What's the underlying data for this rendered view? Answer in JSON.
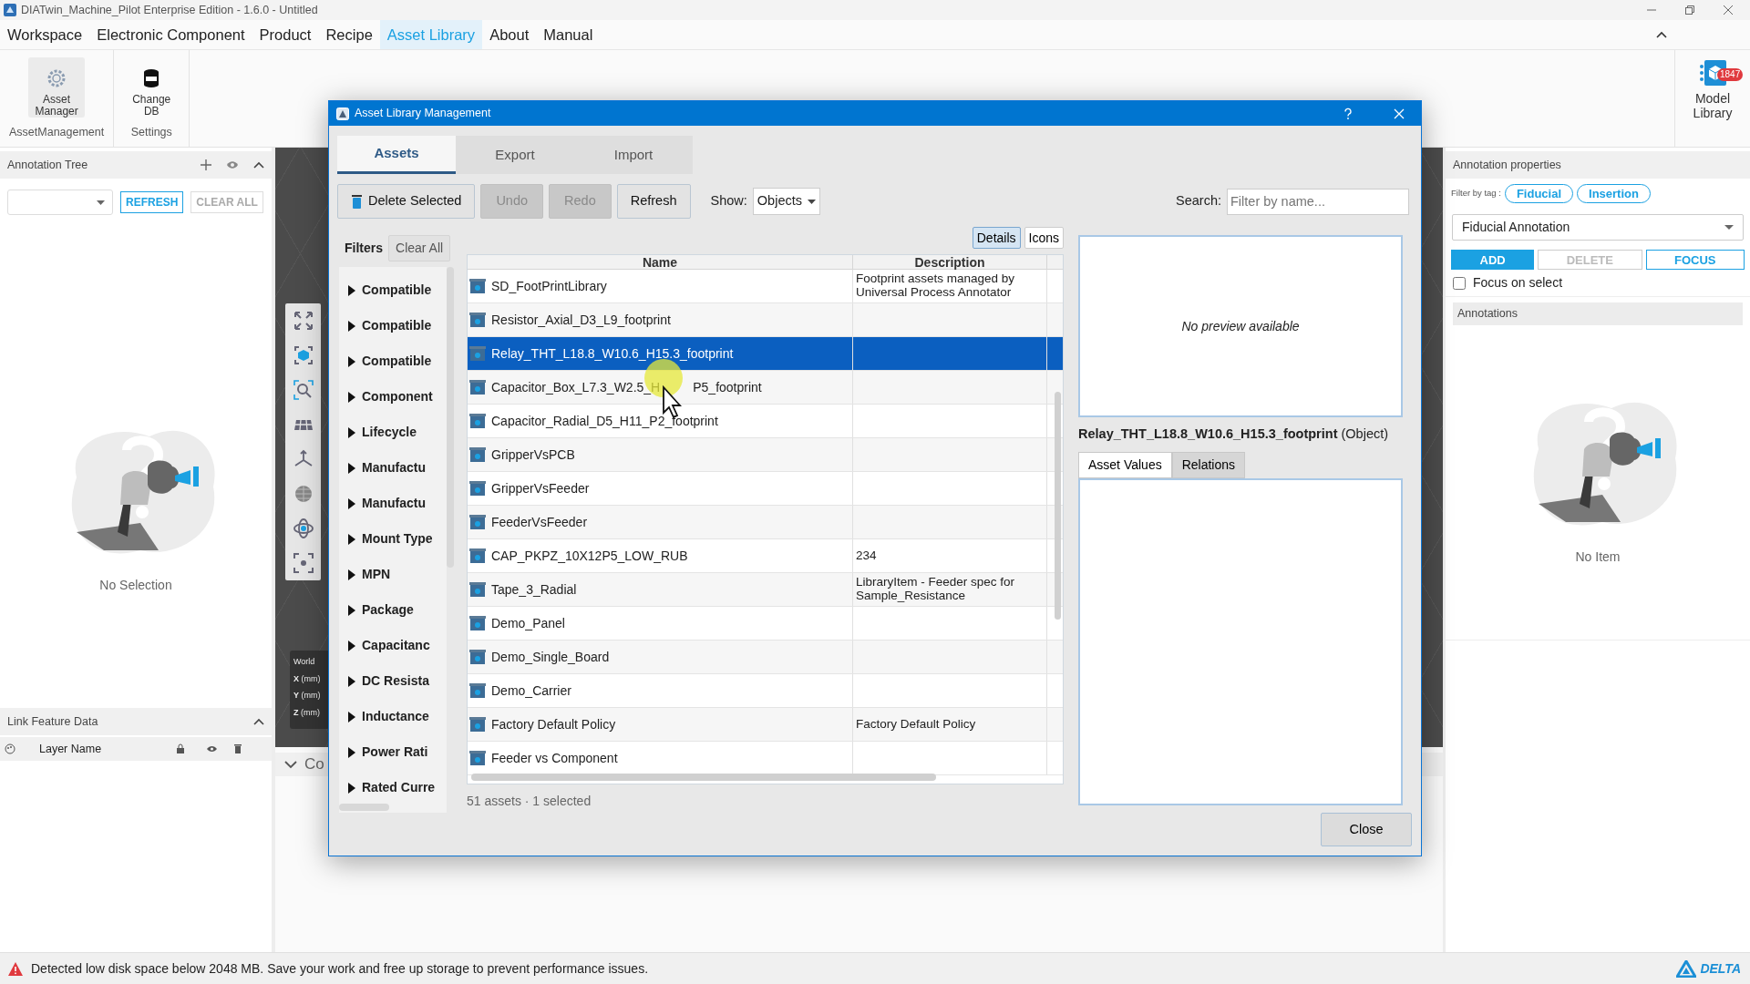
{
  "window": {
    "title": "DIATwin_Machine_Pilot Enterprise Edition - 1.6.0 - Untitled"
  },
  "menu": [
    {
      "label": "Workspace",
      "selected": false
    },
    {
      "label": "Electronic Component",
      "selected": false
    },
    {
      "label": "Product",
      "selected": false
    },
    {
      "label": "Recipe",
      "selected": false
    },
    {
      "label": "Asset Library",
      "selected": true
    },
    {
      "label": "About",
      "selected": false
    },
    {
      "label": "Manual",
      "selected": false
    }
  ],
  "ribbon": {
    "groups": [
      {
        "label": "AssetManagement",
        "buttons": [
          {
            "label": "Asset Manager",
            "kind": "gear",
            "selected": true
          }
        ]
      },
      {
        "label": "Settings",
        "buttons": [
          {
            "label": "Change DB",
            "kind": "database",
            "selected": false
          }
        ]
      }
    ],
    "model_library": {
      "label": "Model Library",
      "badge": "1847"
    }
  },
  "annotation_tree": {
    "title": "Annotation Tree",
    "buttons": [
      {
        "label": "REFRESH",
        "disabled": false
      },
      {
        "label": "CLEAR ALL",
        "disabled": true
      }
    ],
    "empty_text": "No Selection"
  },
  "link_feature_data": {
    "title": "Link Feature Data",
    "columns": [
      "Layer Name"
    ]
  },
  "viewport": {
    "coords_title": "World",
    "axes": [
      {
        "axis": "X",
        "unit": "(mm)"
      },
      {
        "axis": "Y",
        "unit": "(mm)"
      },
      {
        "axis": "Z",
        "unit": "(mm)"
      }
    ],
    "panel_title": "Co"
  },
  "dialog": {
    "title": "Asset Library Management",
    "tabs": [
      {
        "label": "Assets",
        "selected": true
      },
      {
        "label": "Export",
        "selected": false
      },
      {
        "label": "Import",
        "selected": false
      }
    ],
    "toolbar": [
      {
        "label": "Delete Selected",
        "kind": "delete",
        "disabled": false
      },
      {
        "label": "Undo",
        "kind": "plain",
        "disabled": true
      },
      {
        "label": "Redo",
        "kind": "plain",
        "disabled": true
      },
      {
        "label": "Refresh",
        "kind": "plain",
        "disabled": false
      }
    ],
    "show_label": "Show:",
    "show_value": "Objects",
    "search_label": "Search:",
    "search_placeholder": "Filter by name...",
    "filters": {
      "title": "Filters",
      "clear": "Clear All",
      "items": [
        "Compatible",
        "Compatible",
        "Compatible",
        "Component",
        "Lifecycle",
        "Manufactu",
        "Manufactu",
        "Mount Type",
        "MPN",
        "Package",
        "Capacitanc",
        "DC Resista",
        "Inductance",
        "Power Rati",
        "Rated Curre"
      ]
    },
    "view_modes": [
      {
        "label": "Details",
        "selected": true
      },
      {
        "label": "Icons",
        "selected": false
      }
    ],
    "table": {
      "columns": [
        "Name",
        "Description"
      ],
      "rows": [
        {
          "name": "SD_FootPrintLibrary",
          "description": "Footprint assets managed by Universal Process Annotator",
          "selected": false
        },
        {
          "name": "Resistor_Axial_D3_L9_footprint",
          "selected": false
        },
        {
          "name": "Relay_THT_L18.8_W10.6_H15.3_footprint",
          "selected": true
        },
        {
          "name": "Capacitor_Box_L7.3_W2.5_H",
          "name_tail": "P5_footprint",
          "selected": false
        },
        {
          "name": "Capacitor_Radial_D5_H11_P2_footprint",
          "selected": false
        },
        {
          "name": "GripperVsPCB",
          "selected": false
        },
        {
          "name": "GripperVsFeeder",
          "selected": false
        },
        {
          "name": "FeederVsFeeder",
          "selected": false
        },
        {
          "name": "CAP_PKPZ_10X12P5_LOW_RUB",
          "description": "234",
          "selected": false
        },
        {
          "name": "Tape_3_Radial",
          "description": "LibraryItem - Feeder spec for Sample_Resistance",
          "selected": false
        },
        {
          "name": "Demo_Panel",
          "selected": false
        },
        {
          "name": "Demo_Single_Board",
          "selected": false
        },
        {
          "name": "Demo_Carrier",
          "selected": false
        },
        {
          "name": "Factory Default Policy",
          "description": "Factory Default Policy",
          "selected": false
        },
        {
          "name": "Feeder vs Component",
          "selected": false
        }
      ]
    },
    "summary": "51 assets · 1 selected",
    "preview": {
      "empty_text": "No preview available",
      "object_name": "Relay_THT_L18.8_W10.6_H15.3_footprint",
      "object_type": "(Object)"
    },
    "detail_tabs": [
      {
        "label": "Asset Values",
        "selected": true
      },
      {
        "label": "Relations",
        "selected": false
      }
    ],
    "close": "Close"
  },
  "annotation_properties": {
    "title": "Annotation properties",
    "filter_label": "Filter by tag :",
    "tags": [
      "Fiducial",
      "Insertion"
    ],
    "type_value": "Fiducial Annotation",
    "buttons": [
      {
        "label": "ADD",
        "kind": "primary"
      },
      {
        "label": "DELETE",
        "kind": "disabled"
      },
      {
        "label": "FOCUS",
        "kind": "outline"
      }
    ],
    "focus_on_select": {
      "label": "Focus on select",
      "checked": false
    },
    "annotations_title": "Annotations",
    "empty_text": "No Item"
  },
  "status_bar": {
    "message": "Detected low disk space below 2048 MB. Save your work and free up storage to prevent performance issues.",
    "logo": "DELTA"
  }
}
